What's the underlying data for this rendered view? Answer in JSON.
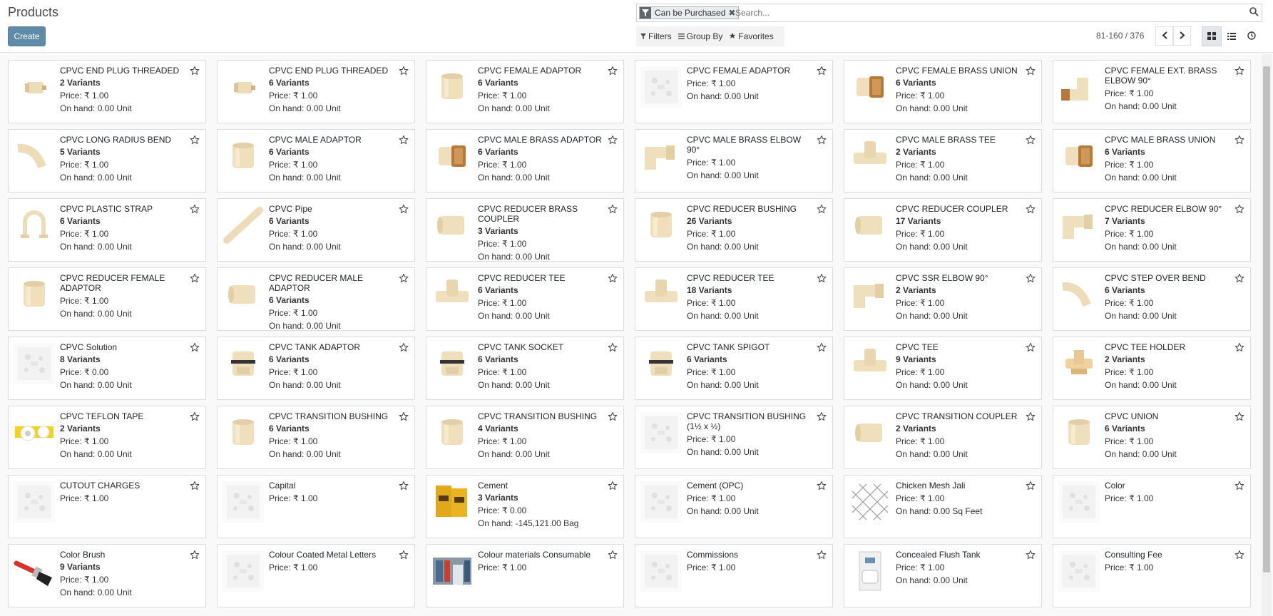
{
  "page": {
    "title": "Products",
    "create_label": "Create"
  },
  "search": {
    "facet_label": "Can be Purchased",
    "placeholder": "Search...",
    "filters_label": "Filters",
    "group_by_label": "Group By",
    "favorites_label": "Favorites"
  },
  "pager": {
    "value": "81-160 / 376"
  },
  "colors": {
    "create_button": "#5f8ba8",
    "facet_icon_bg": "#5c6770"
  },
  "products": [
    {
      "name": "CPVC END PLUG THREADED",
      "variants": "2 Variants",
      "price": "Price: ₹ 1.00",
      "onhand": "On hand: 0.00 Unit",
      "image": "plug-icon"
    },
    {
      "name": "CPVC END PLUG THREADED",
      "variants": "6 Variants",
      "price": "Price: ₹ 1.00",
      "onhand": "On hand: 0.00 Unit",
      "image": "plug-icon"
    },
    {
      "name": "CPVC FEMALE ADAPTOR",
      "variants": "6 Variants",
      "price": "Price: ₹ 1.00",
      "onhand": "On hand: 0.00 Unit",
      "image": "adaptor-icon"
    },
    {
      "name": "CPVC FEMALE ADAPTOR",
      "variants": "",
      "price": "Price: ₹ 1.00",
      "onhand": "On hand: 0.00 Unit",
      "image": "placeholder-image-icon"
    },
    {
      "name": "CPVC FEMALE BRASS UNION",
      "variants": "6 Variants",
      "price": "Price: ₹ 1.00",
      "onhand": "On hand: 0.00 Unit",
      "image": "brass-fitting-icon"
    },
    {
      "name": "CPVC FEMALE EXT. BRASS ELBOW 90°",
      "variants": "",
      "price": "Price: ₹ 1.00",
      "onhand": "On hand: 0.00 Unit",
      "image": "brass-elbow-icon"
    },
    {
      "name": "CPVC LONG RADIUS BEND",
      "variants": "5 Variants",
      "price": "Price: ₹ 1.00",
      "onhand": "On hand: 0.00 Unit",
      "image": "bend-icon"
    },
    {
      "name": "CPVC MALE ADAPTOR",
      "variants": "6 Variants",
      "price": "Price: ₹ 1.00",
      "onhand": "On hand: 0.00 Unit",
      "image": "adaptor-icon"
    },
    {
      "name": "CPVC MALE BRASS ADAPTOR",
      "variants": "6 Variants",
      "price": "Price: ₹ 1.00",
      "onhand": "On hand: 0.00 Unit",
      "image": "brass-fitting-icon"
    },
    {
      "name": "CPVC MALE BRASS ELBOW 90°",
      "variants": "",
      "price": "Price: ₹ 1.00",
      "onhand": "On hand: 0.00 Unit",
      "image": "elbow-icon"
    },
    {
      "name": "CPVC MALE BRASS TEE",
      "variants": "2 Variants",
      "price": "Price: ₹ 1.00",
      "onhand": "On hand: 0.00 Unit",
      "image": "tee-icon"
    },
    {
      "name": "CPVC MALE BRASS UNION",
      "variants": "6 Variants",
      "price": "Price: ₹ 1.00",
      "onhand": "On hand: 0.00 Unit",
      "image": "brass-fitting-icon"
    },
    {
      "name": "CPVC PLASTIC STRAP",
      "variants": "6 Variants",
      "price": "Price: ₹ 1.00",
      "onhand": "On hand: 0.00 Unit",
      "image": "strap-icon"
    },
    {
      "name": "CPVC Pipe",
      "variants": "6 Variants",
      "price": "Price: ₹ 1.00",
      "onhand": "On hand: 0.00 Unit",
      "image": "pipe-icon"
    },
    {
      "name": "CPVC REDUCER BRASS COUPLER",
      "variants": "3 Variants",
      "price": "Price: ₹ 1.00",
      "onhand": "On hand: 0.00 Unit",
      "image": "coupler-icon"
    },
    {
      "name": "CPVC REDUCER BUSHING",
      "variants": "26 Variants",
      "price": "Price: ₹ 1.00",
      "onhand": "On hand: 0.00 Unit",
      "image": "adaptor-icon"
    },
    {
      "name": "CPVC REDUCER COUPLER",
      "variants": "17 Variants",
      "price": "Price: ₹ 1.00",
      "onhand": "On hand: 0.00 Unit",
      "image": "coupler-icon"
    },
    {
      "name": "CPVC REDUCER ELBOW 90°",
      "variants": "7 Variants",
      "price": "Price: ₹ 1.00",
      "onhand": "On hand: 0.00 Unit",
      "image": "elbow-icon"
    },
    {
      "name": "CPVC REDUCER FEMALE ADAPTOR",
      "variants": "",
      "price": "Price: ₹ 1.00",
      "onhand": "On hand: 0.00 Unit",
      "image": "adaptor-icon"
    },
    {
      "name": "CPVC REDUCER MALE ADAPTOR",
      "variants": "6 Variants",
      "price": "Price: ₹ 1.00",
      "onhand": "On hand: 0.00 Unit",
      "image": "coupler-icon"
    },
    {
      "name": "CPVC REDUCER TEE",
      "variants": "6 Variants",
      "price": "Price: ₹ 1.00",
      "onhand": "On hand: 0.00 Unit",
      "image": "tee-icon"
    },
    {
      "name": "CPVC REDUCER TEE",
      "variants": "18 Variants",
      "price": "Price: ₹ 1.00",
      "onhand": "On hand: 0.00 Unit",
      "image": "tee-icon"
    },
    {
      "name": "CPVC SSR ELBOW 90°",
      "variants": "2 Variants",
      "price": "Price: ₹ 1.00",
      "onhand": "On hand: 0.00 Unit",
      "image": "elbow-icon"
    },
    {
      "name": "CPVC STEP OVER BEND",
      "variants": "6 Variants",
      "price": "Price: ₹ 1.00",
      "onhand": "On hand: 0.00 Unit",
      "image": "bend-icon"
    },
    {
      "name": "CPVC Solution",
      "variants": "8 Variants",
      "price": "Price: ₹ 0.00",
      "onhand": "On hand: 0.00 Unit",
      "image": "placeholder-image-icon"
    },
    {
      "name": "CPVC TANK ADAPTOR",
      "variants": "6 Variants",
      "price": "Price: ₹ 1.00",
      "onhand": "On hand: 0.00 Unit",
      "image": "tank-fitting-icon"
    },
    {
      "name": "CPVC TANK SOCKET",
      "variants": "6 Variants",
      "price": "Price: ₹ 1.00",
      "onhand": "On hand: 0.00 Unit",
      "image": "tank-fitting-icon"
    },
    {
      "name": "CPVC TANK SPIGOT",
      "variants": "6 Variants",
      "price": "Price: ₹ 1.00",
      "onhand": "On hand: 0.00 Unit",
      "image": "tank-fitting-icon"
    },
    {
      "name": "CPVC TEE",
      "variants": "9 Variants",
      "price": "Price: ₹ 1.00",
      "onhand": "On hand: 0.00 Unit",
      "image": "tee-icon"
    },
    {
      "name": "CPVC TEE HOLDER",
      "variants": "2 Variants",
      "price": "Price: ₹ 1.00",
      "onhand": "On hand: 0.00 Unit",
      "image": "tee-holder-icon"
    },
    {
      "name": "CPVC TEFLON TAPE",
      "variants": "2 Variants",
      "price": "Price: ₹ 1.00",
      "onhand": "On hand: 0.00 Unit",
      "image": "tape-icon"
    },
    {
      "name": "CPVC TRANSITION BUSHING",
      "variants": "6 Variants",
      "price": "Price: ₹ 1.00",
      "onhand": "On hand: 0.00 Unit",
      "image": "adaptor-icon"
    },
    {
      "name": "CPVC TRANSITION BUSHING",
      "variants": "4 Variants",
      "price": "Price: ₹ 1.00",
      "onhand": "On hand: 0.00 Unit",
      "image": "adaptor-icon"
    },
    {
      "name": "CPVC TRANSITION BUSHING (1½ x ½)",
      "variants": "",
      "price": "Price: ₹ 1.00",
      "onhand": "On hand: 0.00 Unit",
      "image": "placeholder-image-icon"
    },
    {
      "name": "CPVC TRANSITION COUPLER",
      "variants": "2 Variants",
      "price": "Price: ₹ 1.00",
      "onhand": "On hand: 0.00 Unit",
      "image": "coupler-icon"
    },
    {
      "name": "CPVC UNION",
      "variants": "6 Variants",
      "price": "Price: ₹ 1.00",
      "onhand": "On hand: 0.00 Unit",
      "image": "adaptor-icon"
    },
    {
      "name": "CUTOUT CHARGES",
      "variants": "",
      "price": "Price: ₹ 1.00",
      "onhand": "",
      "image": "placeholder-image-icon"
    },
    {
      "name": "Capital",
      "variants": "",
      "price": "Price: ₹ 1.00",
      "onhand": "",
      "image": "placeholder-image-icon"
    },
    {
      "name": "Cement",
      "variants": "3 Variants",
      "price": "Price: ₹ 0.00",
      "onhand": "On hand: -145,121.00 Bag",
      "image": "cement-bag-icon"
    },
    {
      "name": "Cement (OPC)",
      "variants": "",
      "price": "Price: ₹ 1.00",
      "onhand": "On hand: 0.00 Unit",
      "image": "placeholder-image-icon"
    },
    {
      "name": "Chicken Mesh Jali",
      "variants": "",
      "price": "Price: ₹ 1.00",
      "onhand": "On hand: 0.00 Sq Feet",
      "image": "mesh-roll-icon"
    },
    {
      "name": "Color",
      "variants": "",
      "price": "Price: ₹ 1.00",
      "onhand": "",
      "image": "placeholder-image-icon"
    },
    {
      "name": "Color Brush",
      "variants": "9 Variants",
      "price": "Price: ₹ 1.00",
      "onhand": "On hand: 0.00 Unit",
      "image": "paint-brush-icon"
    },
    {
      "name": "Colour Coated Metal Letters",
      "variants": "",
      "price": "Price: ₹ 1.00",
      "onhand": "",
      "image": "placeholder-image-icon"
    },
    {
      "name": "Colour materials Consumable",
      "variants": "",
      "price": "Price: ₹ 1.00",
      "onhand": "",
      "image": "store-photo-icon"
    },
    {
      "name": "Commissions",
      "variants": "",
      "price": "Price: ₹ 1.00",
      "onhand": "",
      "image": "placeholder-image-icon"
    },
    {
      "name": "Concealed Flush Tank",
      "variants": "",
      "price": "Price: ₹ 1.00",
      "onhand": "On hand: 0.00 Unit",
      "image": "flush-tank-icon"
    },
    {
      "name": "Consulting Fee",
      "variants": "",
      "price": "Price: ₹ 1.00",
      "onhand": "",
      "image": "placeholder-image-icon"
    }
  ]
}
